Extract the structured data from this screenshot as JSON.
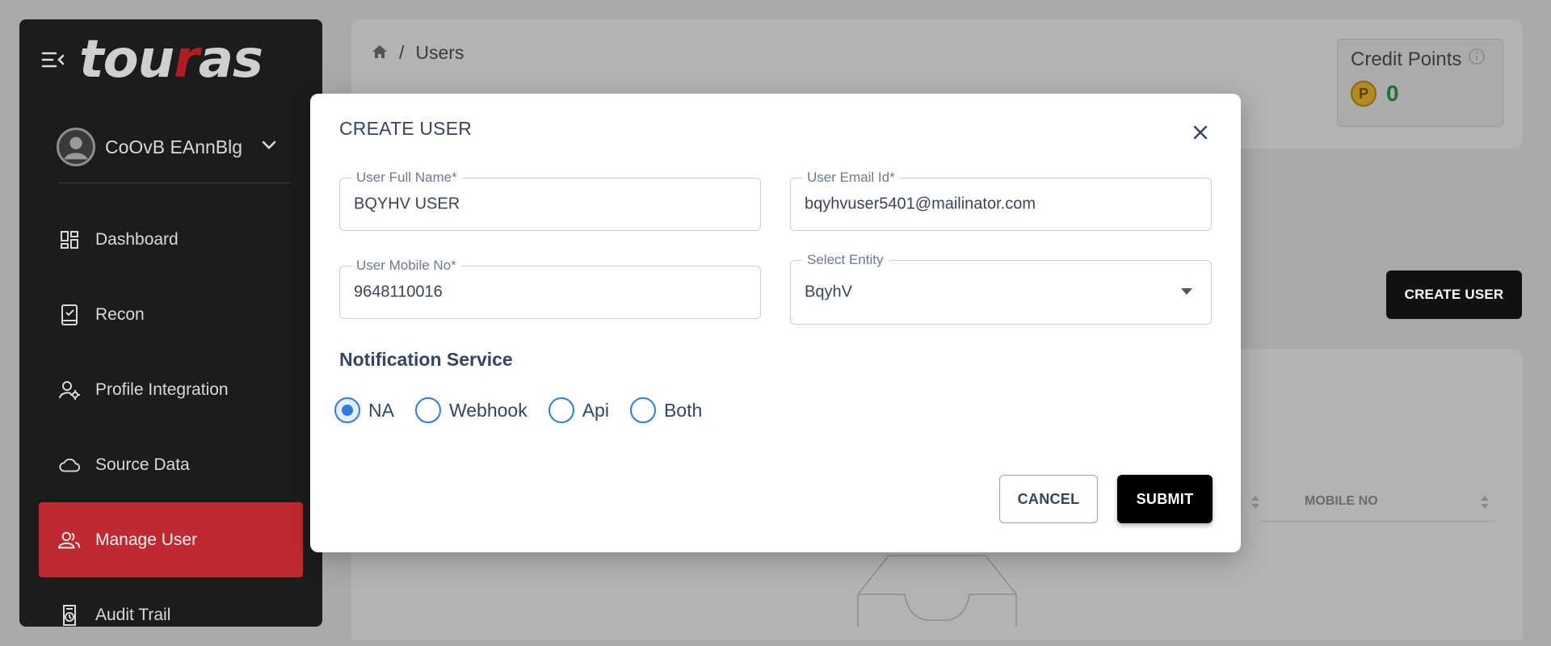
{
  "sidebar": {
    "logo_prefix": "tou",
    "logo_accent": "r",
    "logo_suffix": "as",
    "user_name": "CoOvB EAnnBlg",
    "items": [
      {
        "label": "Dashboard",
        "icon": "dashboard-icon"
      },
      {
        "label": "Recon",
        "icon": "recon-icon"
      },
      {
        "label": "Profile Integration",
        "icon": "profile-settings-icon"
      },
      {
        "label": "Source Data",
        "icon": "cloud-icon"
      },
      {
        "label": "Manage User",
        "icon": "users-icon",
        "active": true
      },
      {
        "label": "Audit Trail",
        "icon": "audit-icon"
      }
    ]
  },
  "breadcrumb": {
    "separator": "/",
    "current": "Users"
  },
  "credit": {
    "title": "Credit Points",
    "coin_symbol": "P",
    "value": "0"
  },
  "page": {
    "create_user_button": "CREATE USER",
    "table_headers": [
      {
        "label": "MOBILE NO"
      }
    ]
  },
  "modal": {
    "title": "CREATE USER",
    "fields": {
      "full_name": {
        "label": "User Full Name*",
        "value": "BQYHV USER"
      },
      "email": {
        "label": "User Email Id*",
        "value": "bqyhvuser5401@mailinator.com"
      },
      "mobile": {
        "label": "User Mobile No*",
        "value": "9648110016"
      },
      "entity": {
        "label": "Select Entity",
        "value": "BqyhV"
      }
    },
    "notification": {
      "title": "Notification Service",
      "options": [
        "NA",
        "Webhook",
        "Api",
        "Both"
      ],
      "selected": "NA"
    },
    "cancel_label": "CANCEL",
    "submit_label": "SUBMIT"
  },
  "colors": {
    "sidebar_bg": "#1c1c1c",
    "active_nav": "#c0292f",
    "radio_accent": "#2f7be0",
    "credit_value": "#1e6f3a"
  }
}
